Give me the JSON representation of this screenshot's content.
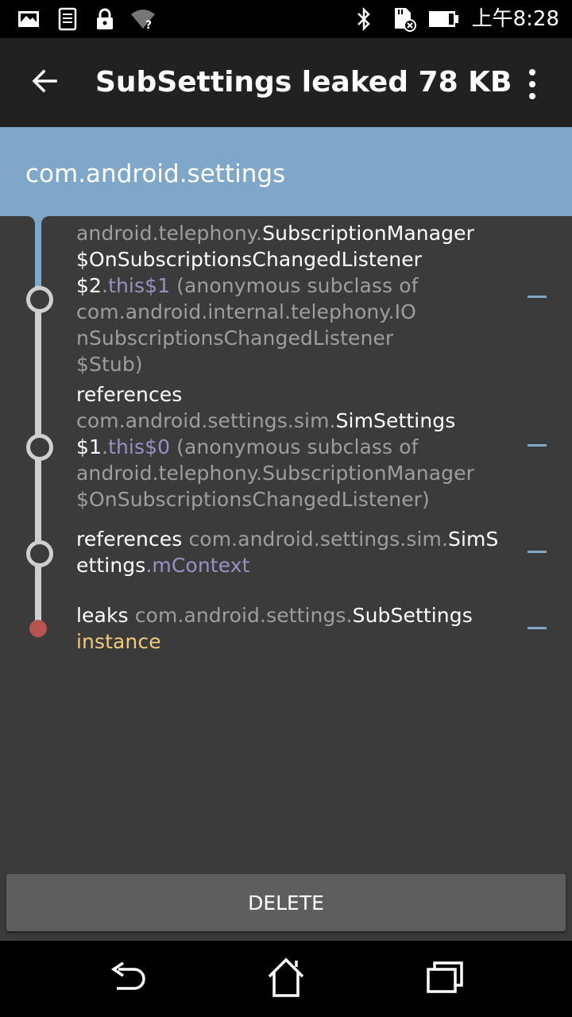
{
  "status_bar": {
    "icons": [
      "image-icon",
      "log-icon",
      "lock-icon",
      "wifi-unknown-icon",
      "bluetooth-icon",
      "sd-card-error-icon",
      "battery-icon"
    ],
    "time": "上午8:28"
  },
  "app_bar": {
    "title": "SubSettings leaked 78 KB",
    "back_icon": "arrow-back-icon",
    "menu_icon": "more-vert-icon"
  },
  "package_header": {
    "name": "com.android.settings"
  },
  "leak_trace": [
    {
      "segments": [
        {
          "text": "android.telephony.",
          "style": "gray"
        },
        {
          "text": "SubscriptionManager\n$OnSubscriptionsChangedListener\n$2",
          "style": "white"
        },
        {
          "text": ".",
          "style": "gray"
        },
        {
          "text": "this$1",
          "style": "purple"
        },
        {
          "text": " (anonymous subclass of\ncom.android.internal.telephony.IO\nnSubscriptionsChangedListener\n$Stub)",
          "style": "gray"
        }
      ]
    },
    {
      "segments": [
        {
          "text": "references\n",
          "style": "white"
        },
        {
          "text": "com.android.settings.sim.",
          "style": "gray"
        },
        {
          "text": "SimSettings\n$1",
          "style": "white"
        },
        {
          "text": ".",
          "style": "gray"
        },
        {
          "text": "this$0",
          "style": "purple"
        },
        {
          "text": " (anonymous subclass of\nandroid.telephony.SubscriptionManager\n$OnSubscriptionsChangedListener)",
          "style": "gray"
        }
      ]
    },
    {
      "segments": [
        {
          "text": "references ",
          "style": "white"
        },
        {
          "text": "com.android.settings.sim.",
          "style": "gray"
        },
        {
          "text": "SimS\nettings",
          "style": "white"
        },
        {
          "text": ".",
          "style": "gray"
        },
        {
          "text": "mContext",
          "style": "purple"
        }
      ]
    },
    {
      "segments": [
        {
          "text": "leaks ",
          "style": "white"
        },
        {
          "text": "com.android.settings.",
          "style": "gray"
        },
        {
          "text": "SubSettings\n",
          "style": "white"
        },
        {
          "text": "instance",
          "style": "yellow"
        }
      ]
    }
  ],
  "delete_button": {
    "label": "DELETE"
  },
  "nav_bar": {
    "buttons": [
      "nav-back-icon",
      "nav-home-icon",
      "nav-recents-icon"
    ]
  },
  "colors": {
    "accent_blue": "#7fa7c9",
    "leak_red": "#b85450",
    "field_purple": "#9b8fc4",
    "instance_yellow": "#f3c97c",
    "background": "#3b3b3b",
    "app_bar": "#212121"
  }
}
